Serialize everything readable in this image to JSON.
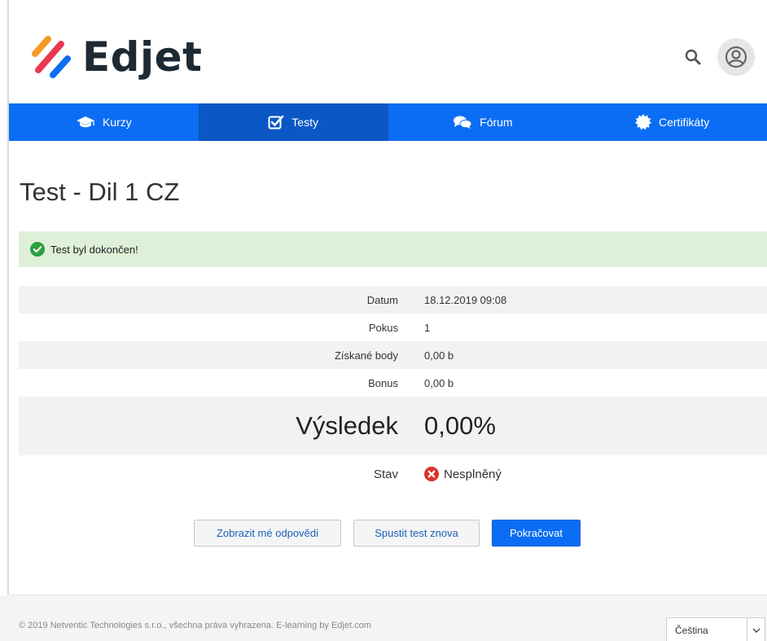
{
  "brand": {
    "name": "Edjet",
    "colors": {
      "orange": "#f59a23",
      "red": "#e8384f",
      "blue": "#0b6df3",
      "dark": "#1e2a33"
    }
  },
  "header": {
    "search_icon": "search-icon",
    "user_icon": "user-circle-icon"
  },
  "nav": {
    "items": [
      {
        "label": "Kurzy",
        "icon": "graduation-cap-icon",
        "active": false
      },
      {
        "label": "Testy",
        "icon": "check-square-icon",
        "active": true
      },
      {
        "label": "Fórum",
        "icon": "comments-icon",
        "active": false
      },
      {
        "label": "Certifikáty",
        "icon": "certificate-icon",
        "active": false
      }
    ]
  },
  "page": {
    "title": "Test - Dil 1 CZ"
  },
  "alert": {
    "text": "Test byl dokončen!",
    "icon": "check-circle-icon"
  },
  "result": {
    "rows": [
      {
        "label": "Datum",
        "value": "18.12.2019 09:08"
      },
      {
        "label": "Pokus",
        "value": "1"
      },
      {
        "label": "Získané body",
        "value": "0,00 b"
      },
      {
        "label": "Bonus",
        "value": "0,00 b"
      }
    ],
    "score_label": "Výsledek",
    "score_value": "0,00%",
    "status_label": "Stav",
    "status_value": "Nesplněný",
    "status_icon": "times-circle-icon"
  },
  "actions": {
    "show_answers": "Zobrazit mé odpovědi",
    "restart": "Spustit test znova",
    "continue": "Pokračovat"
  },
  "footer": {
    "copyright": "© 2019 Netventic Technologies s.r.o., všechna práva vyhrazena. E-learning by Edjet.com",
    "language": "Čeština"
  }
}
